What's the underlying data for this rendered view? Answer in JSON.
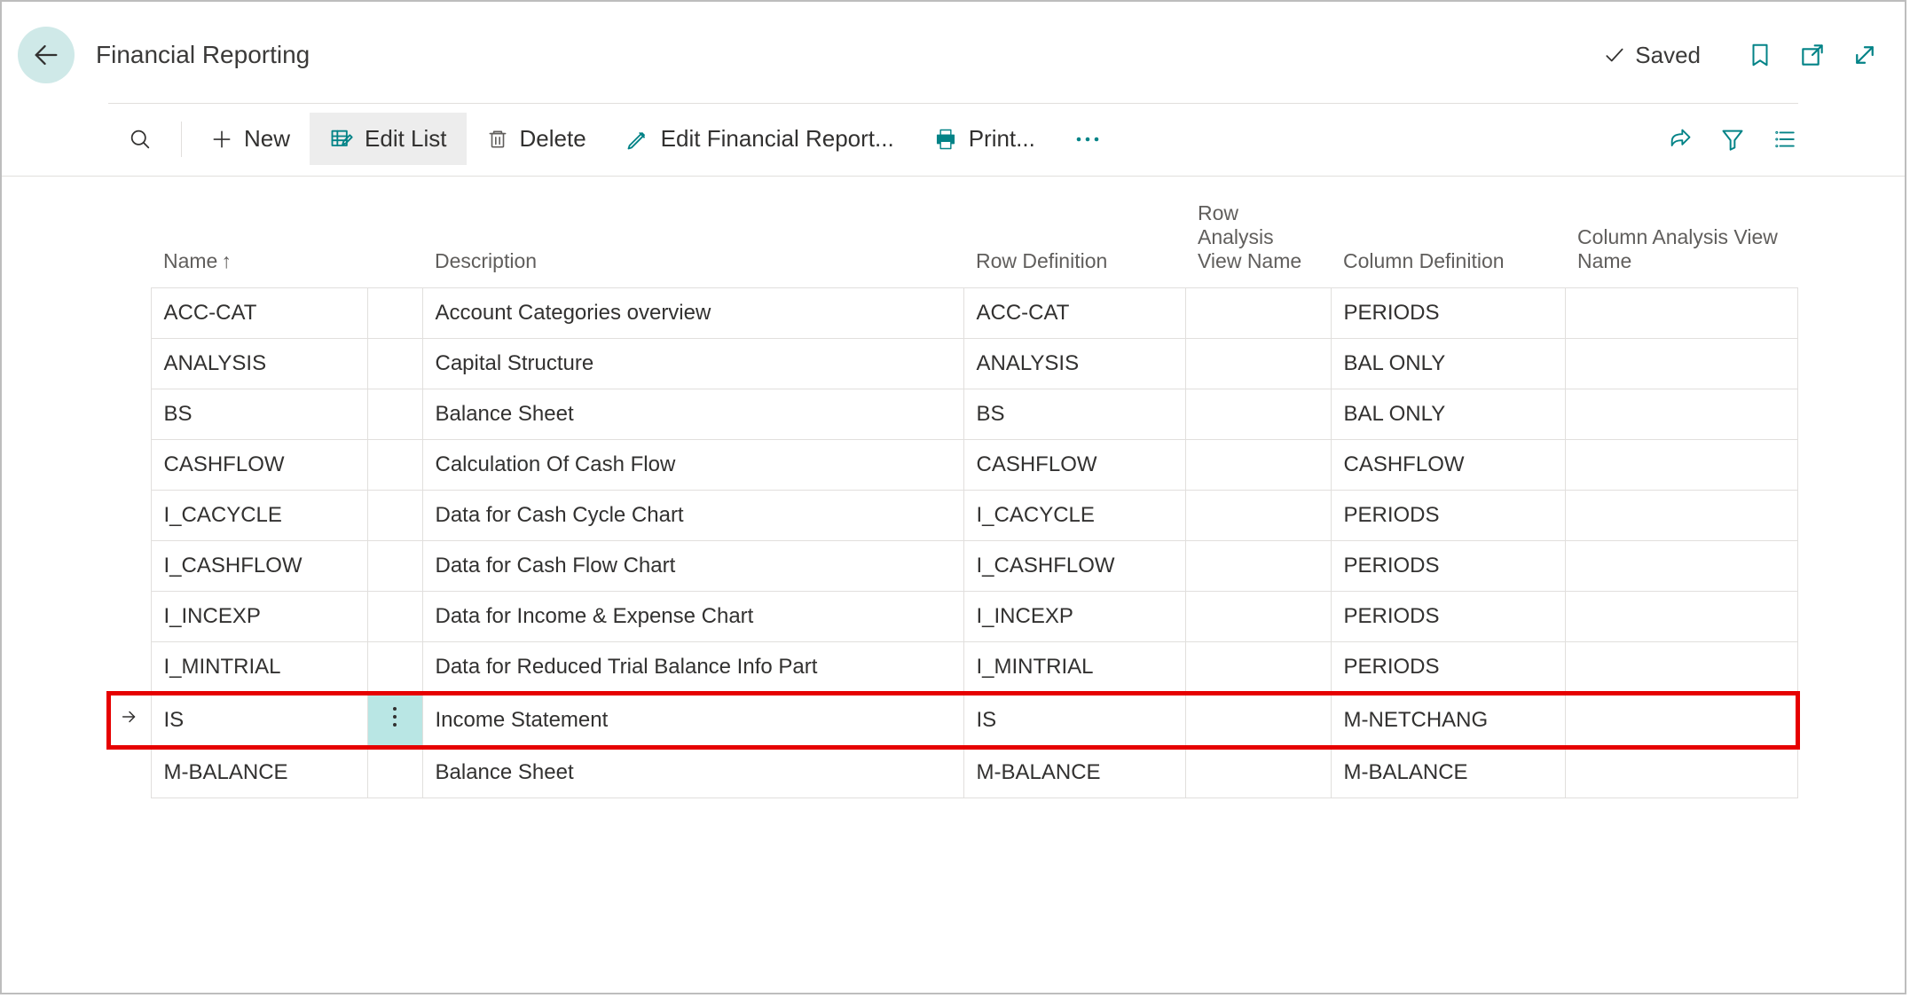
{
  "header": {
    "title": "Financial Reporting",
    "saved_label": "Saved"
  },
  "toolbar": {
    "new_label": "New",
    "edit_list_label": "Edit List",
    "delete_label": "Delete",
    "edit_report_label": "Edit Financial Report...",
    "print_label": "Print..."
  },
  "table": {
    "columns": {
      "name": "Name",
      "description": "Description",
      "row_definition": "Row Definition",
      "row_analysis": "Row Analysis View Name",
      "column_definition": "Column Definition",
      "column_analysis": "Column Analysis View Name"
    },
    "sort_indicator": "↑",
    "rows": [
      {
        "name": "ACC-CAT",
        "description": "Account Categories overview",
        "row_def": "ACC-CAT",
        "row_av": "",
        "col_def": "PERIODS",
        "col_av": "",
        "selected": false
      },
      {
        "name": "ANALYSIS",
        "description": "Capital Structure",
        "row_def": "ANALYSIS",
        "row_av": "",
        "col_def": "BAL ONLY",
        "col_av": "",
        "selected": false
      },
      {
        "name": "BS",
        "description": "Balance Sheet",
        "row_def": "BS",
        "row_av": "",
        "col_def": "BAL ONLY",
        "col_av": "",
        "selected": false
      },
      {
        "name": "CASHFLOW",
        "description": "Calculation Of Cash Flow",
        "row_def": "CASHFLOW",
        "row_av": "",
        "col_def": "CASHFLOW",
        "col_av": "",
        "selected": false
      },
      {
        "name": "I_CACYCLE",
        "description": "Data for Cash Cycle Chart",
        "row_def": "I_CACYCLE",
        "row_av": "",
        "col_def": "PERIODS",
        "col_av": "",
        "selected": false
      },
      {
        "name": "I_CASHFLOW",
        "description": "Data for Cash Flow Chart",
        "row_def": "I_CASHFLOW",
        "row_av": "",
        "col_def": "PERIODS",
        "col_av": "",
        "selected": false
      },
      {
        "name": "I_INCEXP",
        "description": "Data for Income & Expense Chart",
        "row_def": "I_INCEXP",
        "row_av": "",
        "col_def": "PERIODS",
        "col_av": "",
        "selected": false
      },
      {
        "name": "I_MINTRIAL",
        "description": "Data for Reduced Trial Balance Info Part",
        "row_def": "I_MINTRIAL",
        "row_av": "",
        "col_def": "PERIODS",
        "col_av": "",
        "selected": false
      },
      {
        "name": "IS",
        "description": "Income Statement",
        "row_def": "IS",
        "row_av": "",
        "col_def": "M-NETCHANG",
        "col_av": "",
        "selected": true
      },
      {
        "name": "M-BALANCE",
        "description": "Balance Sheet",
        "row_def": "M-BALANCE",
        "row_av": "",
        "col_def": "M-BALANCE",
        "col_av": "",
        "selected": false
      }
    ]
  }
}
